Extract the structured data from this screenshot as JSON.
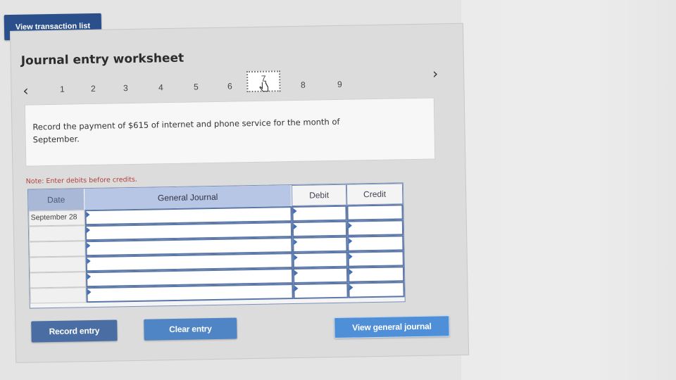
{
  "top_button": {
    "label": "View transaction list"
  },
  "worksheet": {
    "title": "Journal entry worksheet",
    "steps": [
      "1",
      "2",
      "3",
      "4",
      "5",
      "6",
      "7",
      "8",
      "9"
    ],
    "active_step": "7",
    "prompt": "Record the payment of $615 of internet and phone service for the month of September.",
    "note": "Note: Enter debits before credits."
  },
  "journal": {
    "headers": {
      "date": "Date",
      "general_journal": "General Journal",
      "debit": "Debit",
      "credit": "Credit"
    },
    "rows": [
      {
        "date": "September 28",
        "account": "",
        "debit": "",
        "credit": ""
      },
      {
        "date": "",
        "account": "",
        "debit": "",
        "credit": ""
      },
      {
        "date": "",
        "account": "",
        "debit": "",
        "credit": ""
      },
      {
        "date": "",
        "account": "",
        "debit": "",
        "credit": ""
      },
      {
        "date": "",
        "account": "",
        "debit": "",
        "credit": ""
      },
      {
        "date": "",
        "account": "",
        "debit": "",
        "credit": ""
      }
    ]
  },
  "buttons": {
    "record": "Record entry",
    "clear": "Clear entry",
    "view_journal": "View general journal"
  },
  "icons": {
    "prev": "chevron-left-icon",
    "next": "chevron-right-icon",
    "cursor": "hand-pointer-icon"
  },
  "colors": {
    "primary_dark": "#2a4f8a",
    "header_blue": "#b8c6e6",
    "button_blue": "#4f85c4",
    "note_red": "#b0413e"
  }
}
